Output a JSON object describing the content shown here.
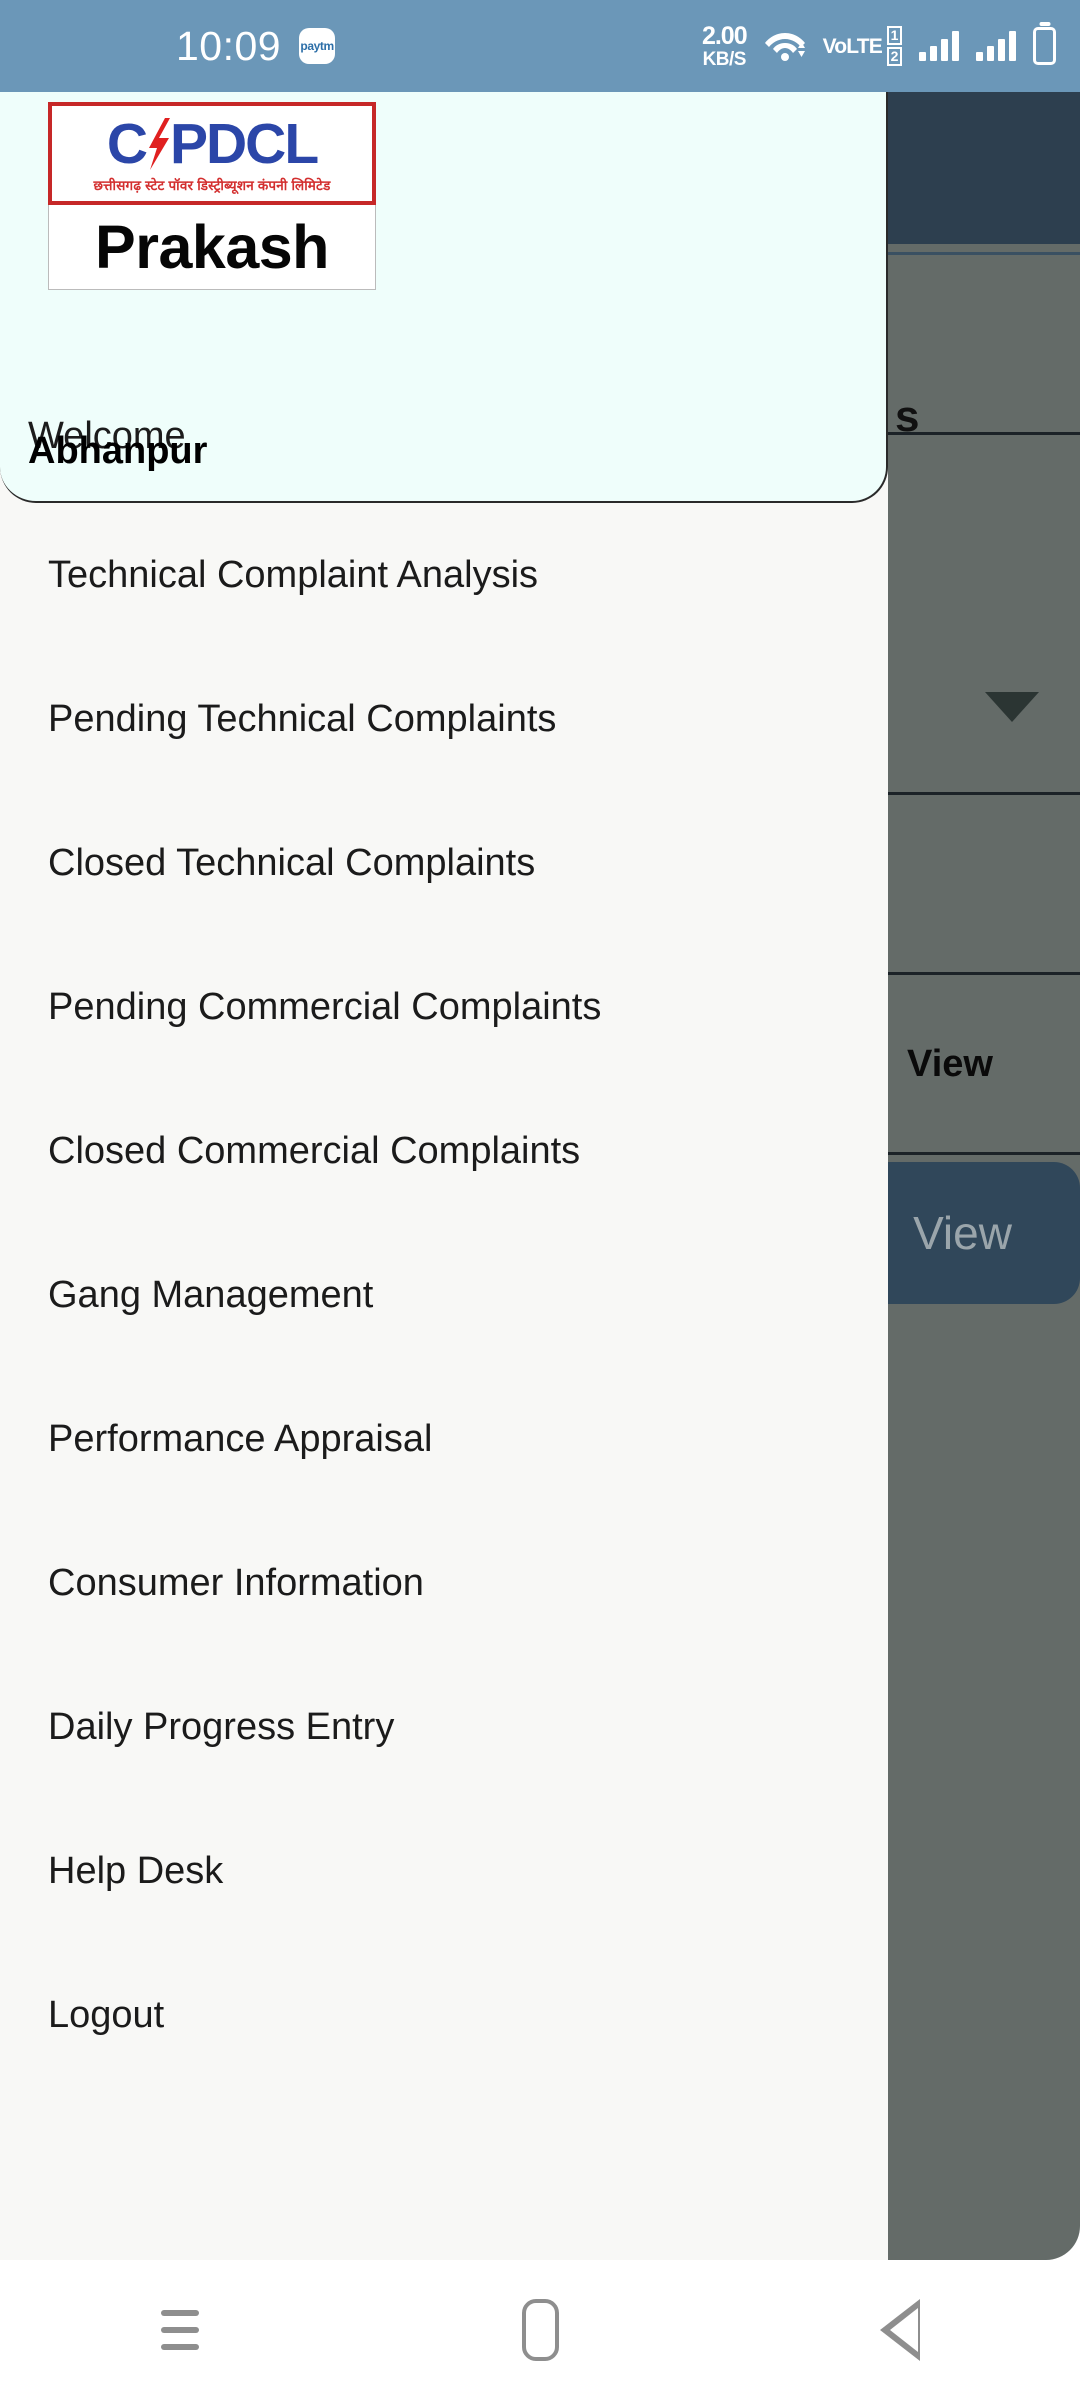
{
  "status_bar": {
    "clock": "10:09",
    "paytm_label": "paytm",
    "net_speed_value": "2.00",
    "net_speed_unit": "KB/S",
    "volte_text": "VoLTE",
    "sim1_label": "1",
    "sim2_label": "2",
    "background_color": "#6b97b8"
  },
  "drawer": {
    "logo": {
      "wordmark_left": "C",
      "wordmark_right": "PDCL",
      "subtitle_hindi": "छत्तीसगढ़ स्टेट पॉवर डिस्ट्रीब्यूशन कंपनी लिमिटेड",
      "brand_blue": "#2b46a8",
      "brand_red": "#c62828"
    },
    "app_name": "Prakash",
    "welcome_label": "Welcome",
    "welcome_name": "Abhanpur",
    "header_background": "#effefb",
    "panel_background": "#f8f8f6",
    "menu_items": [
      {
        "label": "Technical Complaint Analysis"
      },
      {
        "label": "Pending Technical Complaints"
      },
      {
        "label": "Closed Technical Complaints"
      },
      {
        "label": "Pending Commercial Complaints"
      },
      {
        "label": "Closed Commercial Complaints"
      },
      {
        "label": "Gang Management"
      },
      {
        "label": "Performance Appraisal"
      },
      {
        "label": "Consumer Information"
      },
      {
        "label": "Daily Progress Entry"
      },
      {
        "label": "Help Desk"
      },
      {
        "label": "Logout"
      }
    ]
  },
  "background_app": {
    "toolbar_color": "#2d3f4f",
    "scrim_color": "#646b68",
    "partial_title": "s",
    "view_cell_label": "View",
    "view_button_label": "View",
    "view_button_color": "#30475a"
  },
  "system_nav": {
    "recents_label": "Recents",
    "home_label": "Home",
    "back_label": "Back"
  }
}
